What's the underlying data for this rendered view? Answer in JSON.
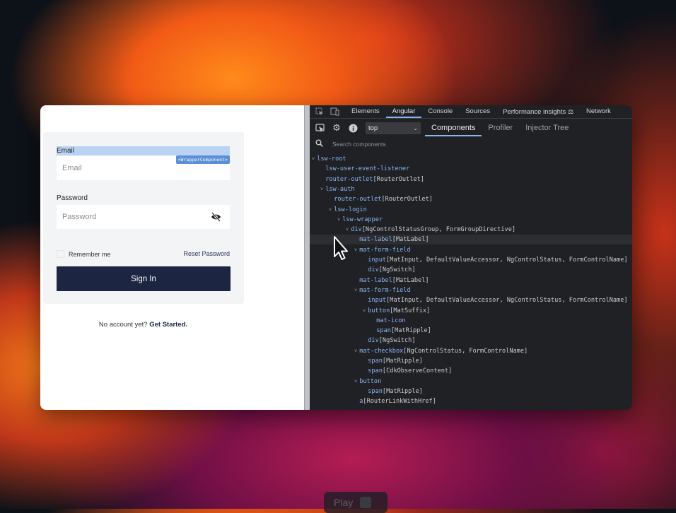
{
  "login": {
    "email_label": "Email",
    "email_placeholder": "Email",
    "wrapper_badge": "<WrapperComponent>",
    "password_label": "Password",
    "password_placeholder": "Password",
    "remember_label": "Remember me",
    "reset_label": "Reset Password",
    "signin_label": "Sign In",
    "no_account_text": "No account yet?",
    "get_started_label": "Get Started."
  },
  "devtools": {
    "tabs": [
      "Elements",
      "Angular",
      "Console",
      "Sources",
      "Performance insights",
      "Network"
    ],
    "active_tab": "Angular",
    "frame_select": "top",
    "subtabs": [
      "Components",
      "Profiler",
      "Injector Tree"
    ],
    "active_subtab": "Components",
    "search_placeholder": "Search components",
    "tree": [
      {
        "depth": 0,
        "arrow": true,
        "name": "lsw-root",
        "dirs": ""
      },
      {
        "depth": 1,
        "arrow": false,
        "name": "lsw-user-event-listener",
        "dirs": ""
      },
      {
        "depth": 1,
        "arrow": false,
        "name": "router-outlet",
        "dirs": "[RouterOutlet]"
      },
      {
        "depth": 1,
        "arrow": true,
        "name": "lsw-auth",
        "dirs": ""
      },
      {
        "depth": 2,
        "arrow": false,
        "name": "router-outlet",
        "dirs": "[RouterOutlet]"
      },
      {
        "depth": 2,
        "arrow": true,
        "name": "lsw-login",
        "dirs": ""
      },
      {
        "depth": 3,
        "arrow": true,
        "name": "lsw-wrapper",
        "dirs": ""
      },
      {
        "depth": 4,
        "arrow": true,
        "name": "div",
        "dirs": "[NgControlStatusGroup, FormGroupDirective]"
      },
      {
        "depth": 5,
        "arrow": false,
        "name": "mat-label",
        "dirs": "[MatLabel]",
        "selected": true
      },
      {
        "depth": 5,
        "arrow": true,
        "name": "mat-form-field",
        "dirs": ""
      },
      {
        "depth": 6,
        "arrow": false,
        "name": "input",
        "dirs": "[MatInput, DefaultValueAccessor, NgControlStatus, FormControlName]"
      },
      {
        "depth": 6,
        "arrow": false,
        "name": "div",
        "dirs": "[NgSwitch]"
      },
      {
        "depth": 5,
        "arrow": false,
        "name": "mat-label",
        "dirs": "[MatLabel]"
      },
      {
        "depth": 5,
        "arrow": true,
        "name": "mat-form-field",
        "dirs": ""
      },
      {
        "depth": 6,
        "arrow": false,
        "name": "input",
        "dirs": "[MatInput, DefaultValueAccessor, NgControlStatus, FormControlName]"
      },
      {
        "depth": 6,
        "arrow": true,
        "name": "button",
        "dirs": "[MatSuffix]"
      },
      {
        "depth": 7,
        "arrow": false,
        "name": "mat-icon",
        "dirs": ""
      },
      {
        "depth": 7,
        "arrow": false,
        "name": "span",
        "dirs": "[MatRipple]"
      },
      {
        "depth": 6,
        "arrow": false,
        "name": "div",
        "dirs": "[NgSwitch]"
      },
      {
        "depth": 5,
        "arrow": true,
        "name": "mat-checkbox",
        "dirs": "[NgControlStatus, FormControlName]"
      },
      {
        "depth": 6,
        "arrow": false,
        "name": "span",
        "dirs": "[MatRipple]"
      },
      {
        "depth": 6,
        "arrow": false,
        "name": "span",
        "dirs": "[CdkObserveContent]"
      },
      {
        "depth": 5,
        "arrow": true,
        "name": "button",
        "dirs": ""
      },
      {
        "depth": 6,
        "arrow": false,
        "name": "span",
        "dirs": "[MatRipple]"
      },
      {
        "depth": 5,
        "arrow": false,
        "name": "a",
        "dirs": "[RouterLinkWithHref]"
      }
    ]
  },
  "overlay": {
    "play_label": "Play"
  }
}
